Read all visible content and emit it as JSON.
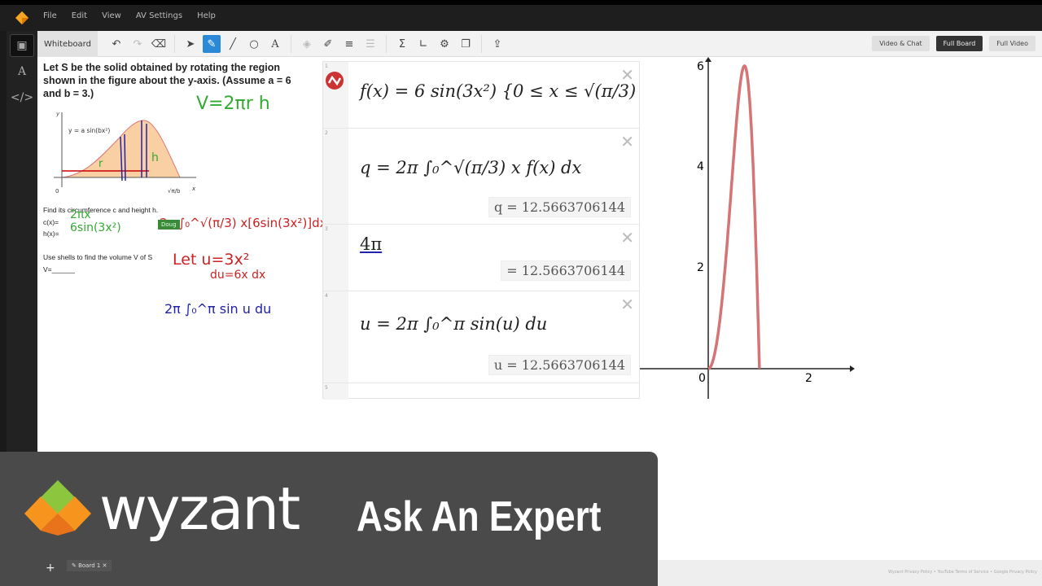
{
  "menu": {
    "items": [
      "File",
      "Edit",
      "View",
      "AV Settings",
      "Help"
    ]
  },
  "toolbar": {
    "whiteboard_tab": "Whiteboard",
    "view_buttons": [
      "Video & Chat",
      "Full Board",
      "Full Video"
    ],
    "active_view": "Full Board",
    "active_tool": "pen"
  },
  "problem": {
    "statement": "Let S be the solid obtained by rotating the region shown in the figure about the y-axis. (Assume a = 6 and b = 3.)",
    "figure_label": "y = a sin(bx²)",
    "fig_y": "y",
    "fig_x": "x",
    "fig_zero": "0",
    "fig_end": "√π/b",
    "find": "Find its circumference c and height h.",
    "c_label": "c(x)=",
    "h_label": "h(x)=",
    "shells": "Use shells to find the volume V of S",
    "v_label": "V=______"
  },
  "handwriting": {
    "formula": "V=2πr h",
    "r": "r",
    "h": "h",
    "c": "2πx",
    "hx": "6sin(3x²)",
    "integral": "2π ∫₀^√(π/3) x[6sin(3x²)]dx",
    "sub1": "Let u=3x²",
    "sub2": "du=6x dx",
    "final": "2π ∫₀^π sin u du",
    "cursor_label": "Doug"
  },
  "calculator": {
    "expressions": [
      {
        "num": "1",
        "latex": "f(x) = 6 sin(3x²) {0 ≤ x ≤ √(π/3)"
      },
      {
        "num": "2",
        "latex": "q = 2π ∫₀^√(π/3) x f(x) dx",
        "result": "q = 12.5663706144"
      },
      {
        "num": "3",
        "latex": "4π",
        "result": "= 12.5663706144"
      },
      {
        "num": "4",
        "latex": "u = 2π ∫₀^π sin(u) du",
        "result": "u = 12.5663706144"
      },
      {
        "num": "5",
        "latex": ""
      }
    ]
  },
  "graph": {
    "x_ticks": [
      "0",
      "2"
    ],
    "y_ticks": [
      "2",
      "4",
      "6"
    ],
    "curve_color": "#d47474"
  },
  "chart_data": {
    "type": "line",
    "function": "6 sin(3x^2), 0 ≤ x ≤ sqrt(pi/3)",
    "x_range": [
      0,
      1.0233
    ],
    "y_peak": 6,
    "x_ticks": [
      0,
      2
    ],
    "y_ticks": [
      2,
      4,
      6
    ]
  },
  "banner": {
    "brand": "wyzant",
    "tagline": "Ask An Expert"
  },
  "tabs": {
    "board": "Board 1"
  },
  "footer": {
    "links": "Wyzant Privacy Policy • YouTube Terms of Service • Google Privacy Policy"
  }
}
